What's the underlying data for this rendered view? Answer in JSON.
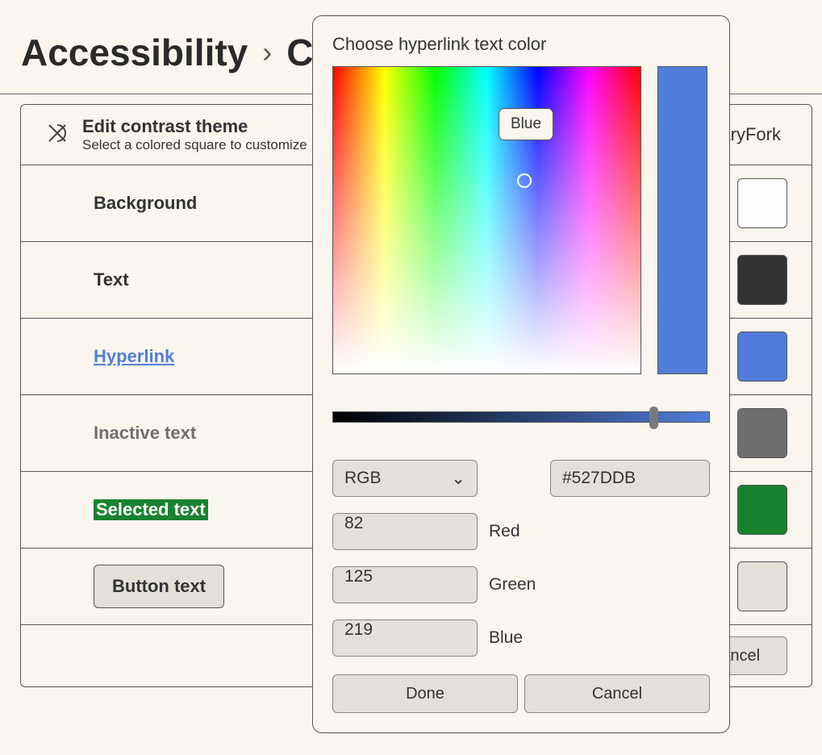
{
  "breadcrumb": {
    "root": "Accessibility",
    "current": "Contrast themes"
  },
  "header": {
    "title": "Edit contrast theme",
    "subtitle": "Select a colored square to customize",
    "theme_name": "CulinaryFork"
  },
  "rows": {
    "background": {
      "label": "Background",
      "color": "#fefefe"
    },
    "text": {
      "label": "Text",
      "color": "#333333"
    },
    "hyperlink": {
      "label": "Hyperlink",
      "color": "#527DDB"
    },
    "inactive": {
      "label": "Inactive text",
      "color": "#6f6f6f"
    },
    "selected": {
      "label": "Selected text",
      "color": "#19822f"
    },
    "button": {
      "label": "Button text",
      "color": "#e3e0d8"
    }
  },
  "footer": {
    "cancel": "Cancel"
  },
  "dialog": {
    "title": "Choose hyperlink text color",
    "tooltip": "Blue",
    "mode": "RGB",
    "hex": "#527DDB",
    "channels": {
      "r_label": "Red",
      "r_value": "82",
      "g_label": "Green",
      "g_value": "125",
      "b_label": "Blue",
      "b_value": "219"
    },
    "done": "Done",
    "cancel": "Cancel"
  }
}
